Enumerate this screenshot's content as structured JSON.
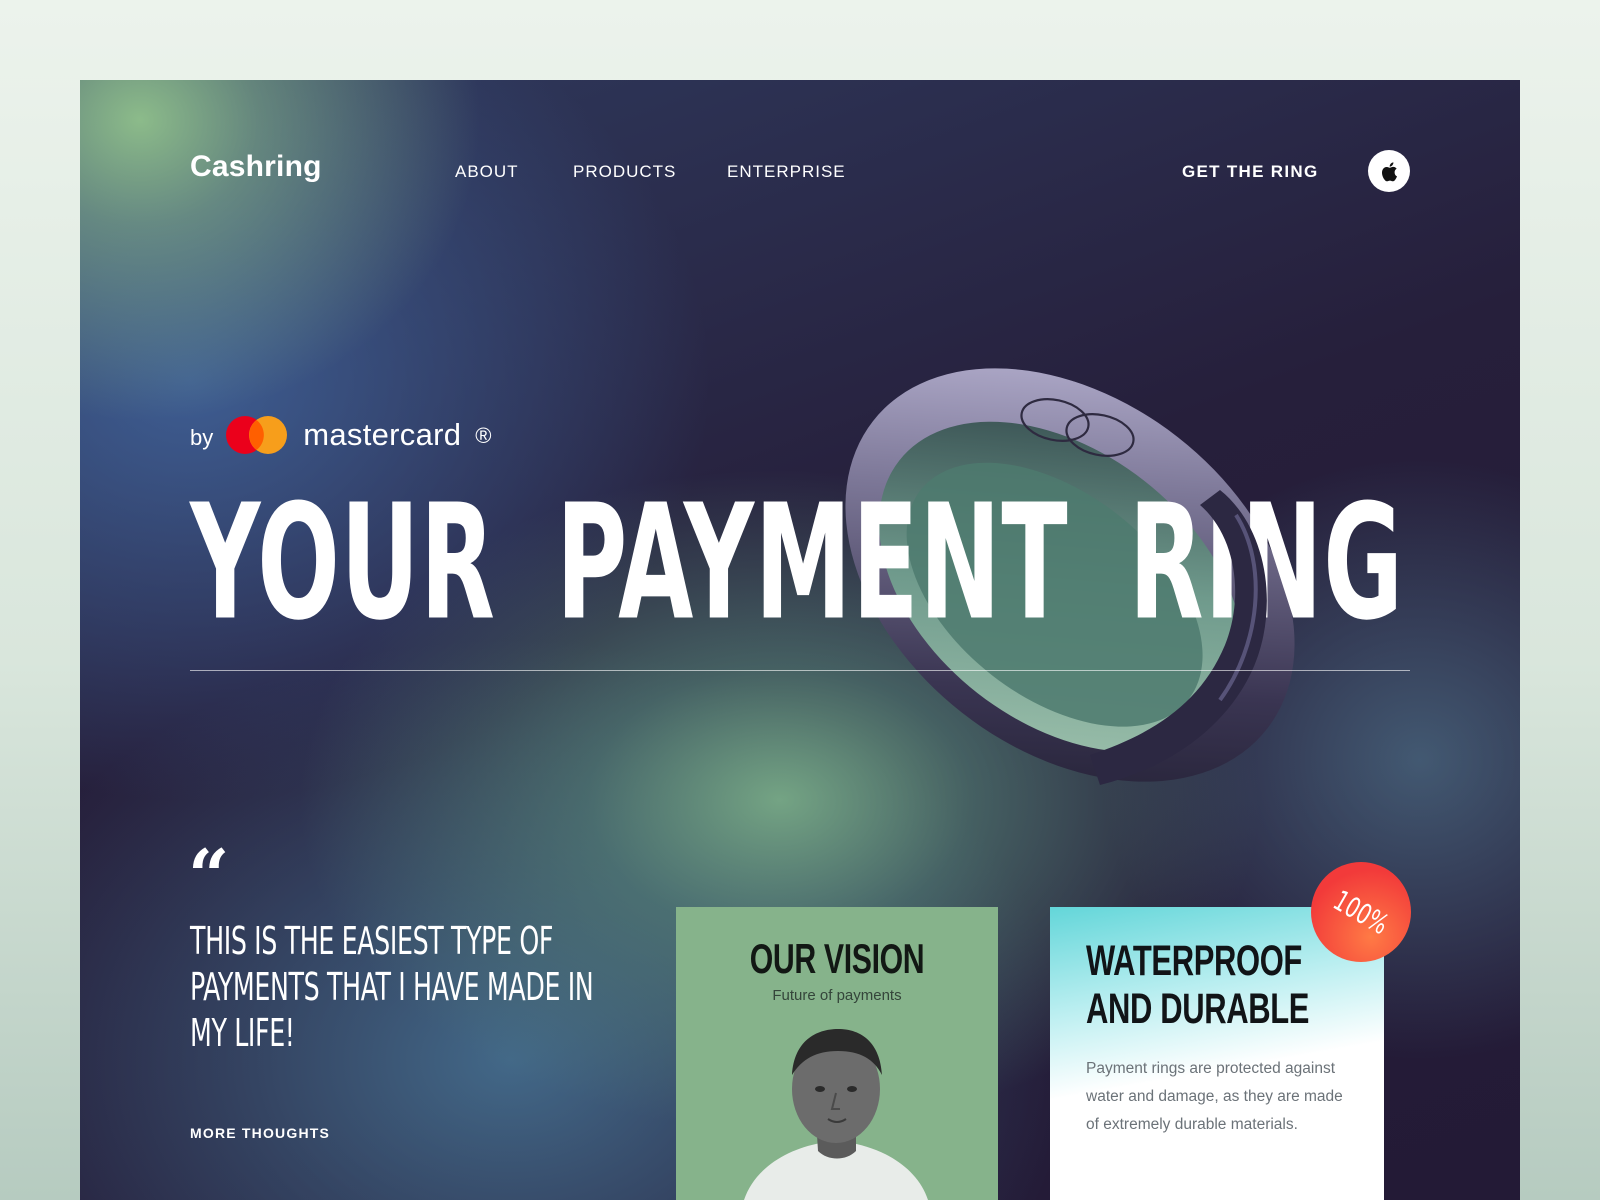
{
  "brand": {
    "name": "Cashring"
  },
  "nav": {
    "items": [
      {
        "label": "ABOUT"
      },
      {
        "label": "PRODUCTS"
      },
      {
        "label": "ENTERPRISE"
      }
    ],
    "cta_label": "GET THE RING",
    "app_icon": "apple-icon"
  },
  "hero": {
    "by_label": "by",
    "partner_name": "mastercard",
    "partner_mark": "®",
    "headline": "YOUR PAYMENT RING",
    "image": "payment-ring"
  },
  "testimonial": {
    "quote_mark": "“",
    "text": "THIS IS THE EASIEST TYPE OF PAYMENTS THAT I HAVE MADE IN MY LIFE!",
    "link_label": "MORE THOUGHTS"
  },
  "cards": {
    "vision": {
      "title": "OUR VISION",
      "subtitle": "Future of payments",
      "image": "man-portrait"
    },
    "waterproof": {
      "title": "WATERPROOF AND DURABLE",
      "description": "Payment rings are protected against water and damage, as they are made of extremely durable materials.",
      "badge": "100%"
    }
  },
  "colors": {
    "mastercard_red": "#eb001b",
    "mastercard_orange": "#f79e1b",
    "vision_card": "#86b38b",
    "waterproof_gradient_top": "#63d6d9",
    "badge": "#f23a3a"
  }
}
